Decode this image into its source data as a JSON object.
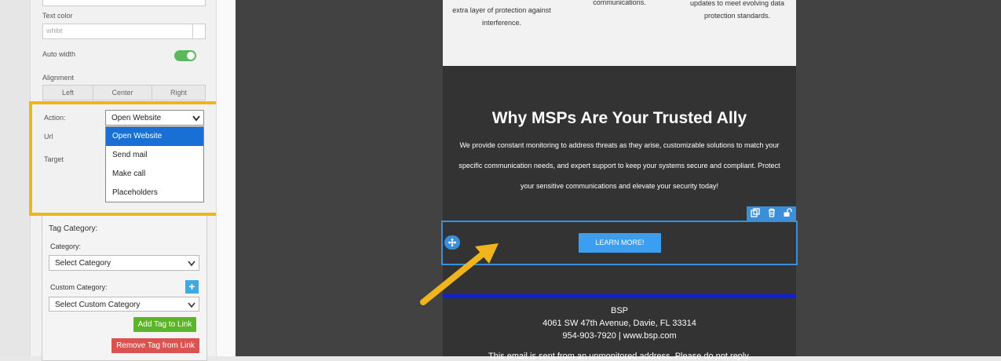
{
  "panel": {
    "text_color_label": "Text color",
    "text_color_value": "white",
    "auto_width_label": "Auto width",
    "alignment_label": "Alignment",
    "alignment_options": [
      "Left",
      "Center",
      "Right"
    ],
    "action_label": "Action:",
    "action_value": "Open Website",
    "url_label": "Url",
    "target_label": "Target",
    "action_options": [
      "Open Website",
      "Send mail",
      "Make call",
      "Placeholders"
    ],
    "tag_category_label": "Tag Category:",
    "category_label": "Category:",
    "category_select": "Select Category",
    "custom_category_label": "Custom Category:",
    "custom_category_select": "Select Custom Category",
    "add_tag_button": "Add Tag to Link",
    "remove_tag_button": "Remove Tag from Link"
  },
  "email": {
    "top_col1": [
      "extra layer of protection against",
      "interference."
    ],
    "top_col2": [
      "communications."
    ],
    "top_col3": [
      "updates to meet evolving data",
      "protection standards."
    ],
    "heading": "Why MSPs Are Your Trusted Ally",
    "body_lines": [
      "We provide constant monitoring to address threats as they arise, customizable solutions to match your",
      "specific communication needs, and expert support to keep your systems secure and compliant. Protect",
      "your sensitive communications and elevate your security today!"
    ],
    "cta_label": "LEARN MORE!",
    "footer_company": "BSP",
    "footer_address": "4061 SW 47th Avenue, Davie, FL 33314",
    "footer_contact": "954-903-7920 | www.bsp.com",
    "footer_note": "This email is sent from an unmonitored address. Please do not reply."
  },
  "colors": {
    "highlight": "#f0b51c",
    "accent_blue": "#3b8fd9",
    "cta_blue": "#3b9ef0",
    "divider_blue": "#1020d8"
  },
  "icons": [
    "copy-icon",
    "trash-icon",
    "unlock-icon",
    "move-icon",
    "chevron-down-icon",
    "plus-icon",
    "arrow-annotation"
  ]
}
